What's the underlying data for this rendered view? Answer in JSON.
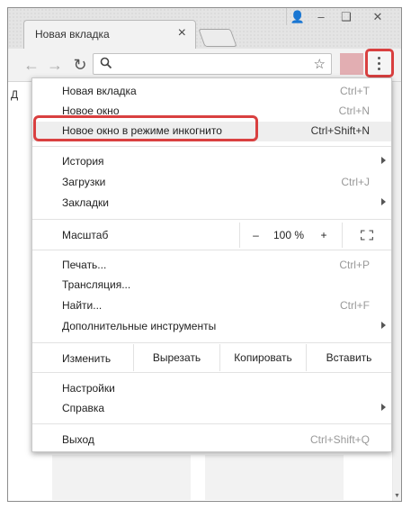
{
  "tab": {
    "title": "Новая вкладка",
    "close": "×"
  },
  "window": {
    "user": "👤",
    "min": "–",
    "max": "❑",
    "close": "✕"
  },
  "toolbar": {
    "back": "←",
    "forward": "→",
    "reload": "↻",
    "star": "☆",
    "bookmarks_partial": "Д"
  },
  "menu": {
    "new_tab": {
      "label": "Новая вкладка",
      "shortcut": "Ctrl+T"
    },
    "new_window": {
      "label": "Новое окно",
      "shortcut": "Ctrl+N"
    },
    "incognito": {
      "label": "Новое окно в режиме инкогнито",
      "shortcut": "Ctrl+Shift+N"
    },
    "history": {
      "label": "История"
    },
    "downloads": {
      "label": "Загрузки",
      "shortcut": "Ctrl+J"
    },
    "bookmarks": {
      "label": "Закладки"
    },
    "zoom": {
      "label": "Масштаб",
      "minus": "–",
      "value": "100 %",
      "plus": "+"
    },
    "print": {
      "label": "Печать...",
      "shortcut": "Ctrl+P"
    },
    "cast": {
      "label": "Трансляция..."
    },
    "find": {
      "label": "Найти...",
      "shortcut": "Ctrl+F"
    },
    "more_tools": {
      "label": "Дополнительные инструменты"
    },
    "edit": {
      "label": "Изменить",
      "cut": "Вырезать",
      "copy": "Копировать",
      "paste": "Вставить"
    },
    "settings": {
      "label": "Настройки"
    },
    "help": {
      "label": "Справка"
    },
    "exit": {
      "label": "Выход",
      "shortcut": "Ctrl+Shift+Q"
    }
  },
  "colors": {
    "highlight": "#d94040",
    "extension": "#e2aeb2"
  },
  "icons": [
    "search-icon",
    "star-icon",
    "menu-dots-icon",
    "fullscreen-icon",
    "back-arrow-icon",
    "forward-arrow-icon",
    "reload-icon"
  ]
}
